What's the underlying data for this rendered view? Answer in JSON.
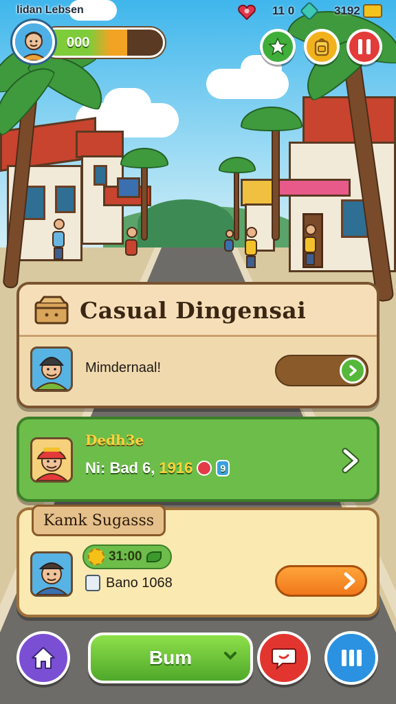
{
  "hud": {
    "player_name": "lidan Lebsen",
    "xp_value": "000",
    "xp_progress": 0.7,
    "stat_lives": "11 0",
    "stat_currency": "3192",
    "menu_buttons": [
      {
        "name": "achievements",
        "icon": "star-icon",
        "color": "#3fae3a"
      },
      {
        "name": "inventory",
        "icon": "backpack-icon",
        "color": "#f2b21c"
      },
      {
        "name": "pause",
        "icon": "pause-icon",
        "color": "#e33a3a"
      }
    ]
  },
  "quest_panel": {
    "title": "Casual Dingensai",
    "subtitle": "Mimdernaal!",
    "icon": "chest-icon"
  },
  "reward_panel": {
    "title": "Dedh3e",
    "line_label": "Ni: Bad",
    "line_value1": "6,",
    "line_value2": "1916",
    "line_value3": "9",
    "icon": "arrow-right-icon"
  },
  "offer_panel": {
    "tag": "Kamk Sugasss",
    "pill_value": "31:00",
    "line_text": "Bano 1068",
    "icon": "lock-icon"
  },
  "bottom_bar": {
    "home_icon": "home-icon",
    "main_label": "Bum",
    "chat_icon": "chat-icon",
    "menu_icon": "menu-bars-icon",
    "colors": {
      "home": "#7b4fd4",
      "main": "#5cc03a",
      "chat": "#e3352f",
      "menu": "#2a92e0"
    }
  }
}
